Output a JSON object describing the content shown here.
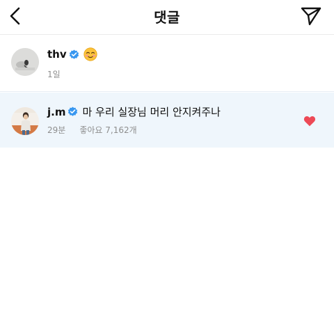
{
  "header": {
    "title": "댓글",
    "back_icon": "chevron-left-icon",
    "send_icon": "paper-plane-icon"
  },
  "post": {
    "username": "thv",
    "verified": true,
    "caption_emoji": "smiling-face-icon",
    "time": "1일"
  },
  "comments": [
    {
      "username": "j.m",
      "verified": true,
      "text": "마 우리 실장님 머리 안지켜주나",
      "time": "29분",
      "likes": "좋아요 7,162개",
      "liked": true
    }
  ],
  "colors": {
    "verified_badge": "#3897f0",
    "like_heart": "#ed4956",
    "reply_background": "#eff6fc",
    "meta_text": "#8e8e8e"
  }
}
